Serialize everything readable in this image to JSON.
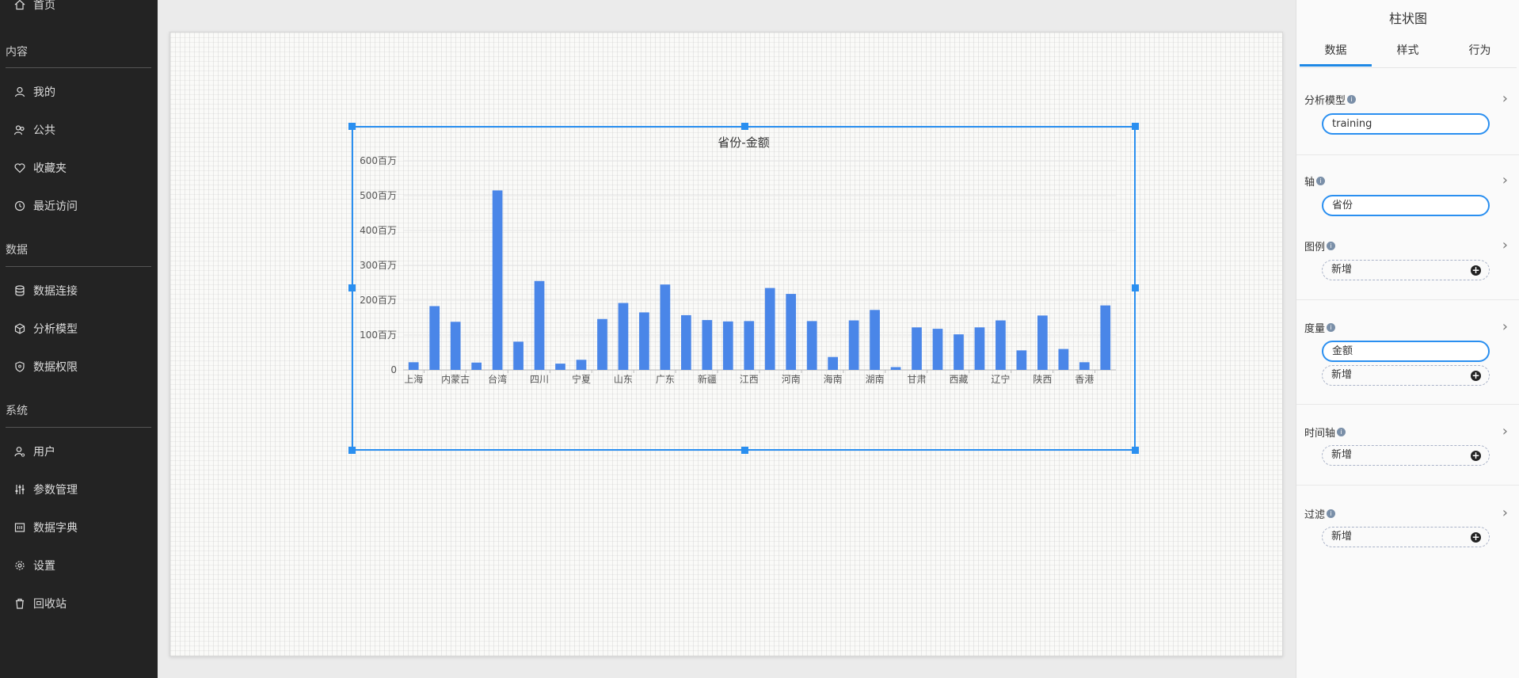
{
  "sidebar": {
    "home": "首页",
    "section_content": "内容",
    "items_content": [
      "我的",
      "公共",
      "收藏夹",
      "最近访问"
    ],
    "section_data": "数据",
    "items_data": [
      "数据连接",
      "分析模型",
      "数据权限"
    ],
    "section_system": "系统",
    "items_system": [
      "用户",
      "参数管理",
      "数据字典",
      "设置",
      "回收站"
    ]
  },
  "panel": {
    "title": "柱状图",
    "tabs": [
      "数据",
      "样式",
      "行为"
    ],
    "active_tab": "数据",
    "sections": {
      "model_label": "分析模型",
      "model_value": "training",
      "axis_label": "轴",
      "axis_value": "省份",
      "legend_label": "图例",
      "measure_label": "度量",
      "measure_value": "金额",
      "time_axis_label": "时间轴",
      "filter_label": "过滤",
      "add_label": "新增"
    },
    "accent_color": "#2a8ff0"
  },
  "chart_data": {
    "type": "bar",
    "title": "省份-金额",
    "xlabel": "",
    "ylabel": "",
    "ylim": [
      0,
      600
    ],
    "yticks": [
      "0",
      "100百万",
      "200百万",
      "300百万",
      "400百万",
      "500百万",
      "600百万"
    ],
    "x_tick_labels": [
      "上海",
      "内蒙古",
      "台湾",
      "四川",
      "宁夏",
      "山东",
      "广东",
      "新疆",
      "江西",
      "河南",
      "海南",
      "湖南",
      "甘肃",
      "西藏",
      "辽宁",
      "陕西",
      "香港"
    ],
    "values": [
      22,
      183,
      138,
      21,
      515,
      81,
      255,
      18,
      29,
      146,
      192,
      165,
      245,
      157,
      143,
      139,
      140,
      235,
      218,
      140,
      37,
      142,
      172,
      8,
      122,
      118,
      102,
      122,
      142,
      56,
      156,
      60,
      22,
      185
    ],
    "unit": "百万",
    "bar_color": "#4a86e8",
    "grid": true
  }
}
